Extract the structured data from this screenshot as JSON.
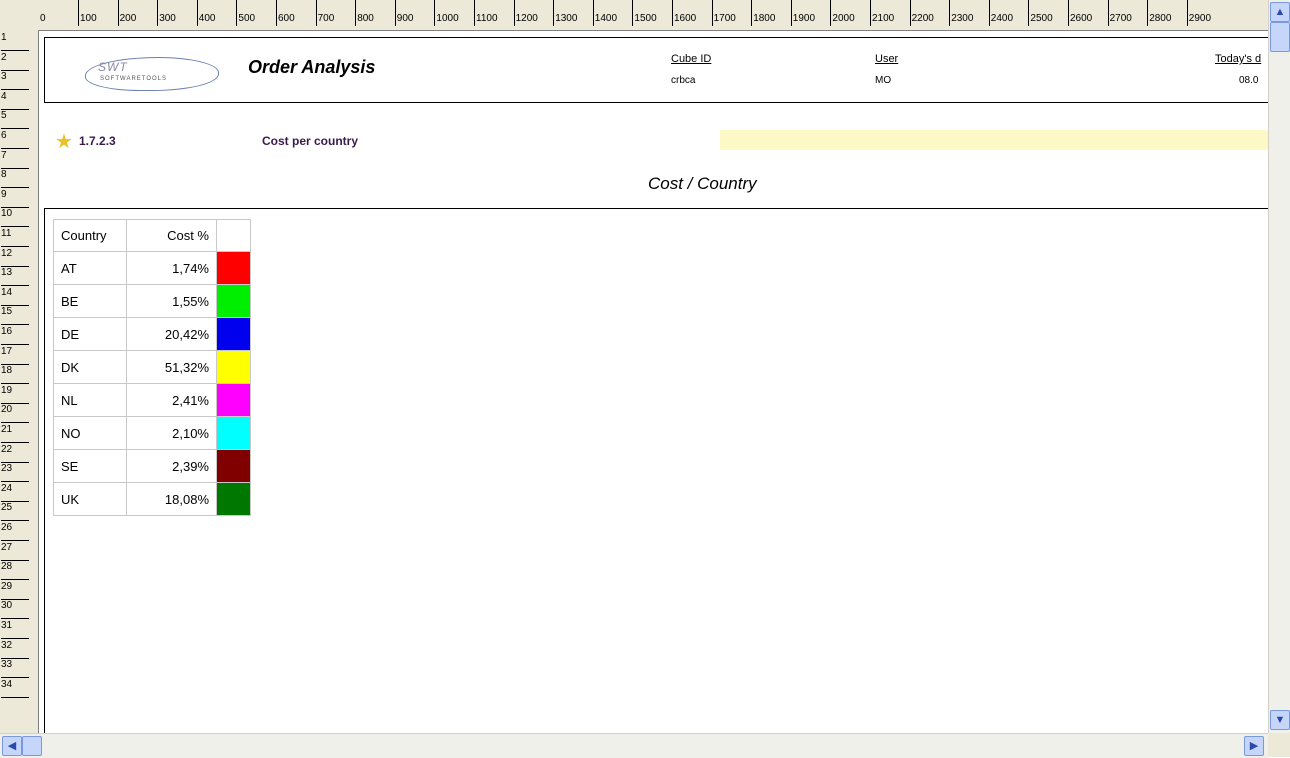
{
  "ruler": {
    "top_labels": [
      "0",
      "100",
      "200",
      "300",
      "400",
      "500",
      "600",
      "700",
      "800",
      "900",
      "1000",
      "1100",
      "1200",
      "1300",
      "1400",
      "1500",
      "1600",
      "1700",
      "1800",
      "1900",
      "2000",
      "2100",
      "2200",
      "2300",
      "2400",
      "2500",
      "2600",
      "2700",
      "2800",
      "2900"
    ],
    "left_labels": [
      "1",
      "2",
      "3",
      "4",
      "5",
      "6",
      "7",
      "8",
      "9",
      "10",
      "11",
      "12",
      "13",
      "14",
      "15",
      "16",
      "17",
      "18",
      "19",
      "20",
      "21",
      "22",
      "23",
      "24",
      "25",
      "26",
      "27",
      "28",
      "29",
      "30",
      "31",
      "32",
      "33",
      "34"
    ]
  },
  "header": {
    "logo_text": "SWT",
    "logo_sub": "SOFTWARETOOLS",
    "title": "Order Analysis",
    "cube_id_label": "Cube ID",
    "cube_id_value": "crbca",
    "user_label": "User",
    "user_value": "MO",
    "today_label": "Today's d",
    "today_value": "08.0"
  },
  "section": {
    "number": "1.7.2.3",
    "title": "Cost per country"
  },
  "chart_title": "Cost / Country",
  "legend": {
    "col_country": "Country",
    "col_cost": "Cost %",
    "rows": [
      {
        "country": "AT",
        "cost": "1,74%",
        "color": "#ff0000"
      },
      {
        "country": "BE",
        "cost": "1,55%",
        "color": "#00ee00"
      },
      {
        "country": "DE",
        "cost": "20,42%",
        "color": "#0000ee"
      },
      {
        "country": "DK",
        "cost": "51,32%",
        "color": "#ffff00"
      },
      {
        "country": "NL",
        "cost": "2,41%",
        "color": "#ff00ff"
      },
      {
        "country": "NO",
        "cost": "2,10%",
        "color": "#00ffff"
      },
      {
        "country": "SE",
        "cost": "2,39%",
        "color": "#800000"
      },
      {
        "country": "UK",
        "cost": "18,08%",
        "color": "#007800"
      }
    ]
  },
  "scroll": {
    "up_icon": "▲",
    "down_icon": "▼",
    "left_icon": "◀",
    "right_icon": "▶"
  }
}
